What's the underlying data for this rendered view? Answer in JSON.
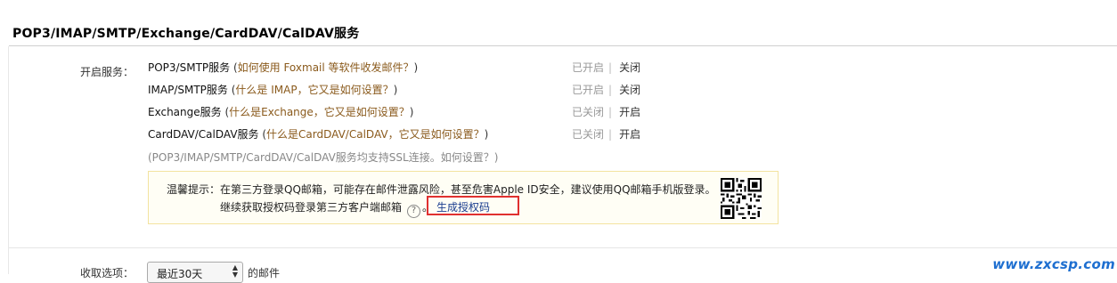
{
  "section": {
    "title": "POP3/IMAP/SMTP/Exchange/CardDAV/CalDAV服务"
  },
  "enable_label": "开启服务：",
  "services": [
    {
      "name": "POP3/SMTP服务",
      "open_paren": " (",
      "help": "如何使用 Foxmail 等软件收发邮件？",
      "close_paren": ")",
      "status": "已开启",
      "sep": "|",
      "action": "关闭"
    },
    {
      "name": "IMAP/SMTP服务",
      "open_paren": " (",
      "help": "什么是 IMAP，它又是如何设置？",
      "close_paren": ")",
      "status": "已开启",
      "sep": "|",
      "action": "关闭"
    },
    {
      "name": "Exchange服务",
      "open_paren": " (",
      "help": "什么是Exchange，它又是如何设置？",
      "close_paren": ")",
      "status": "已关闭",
      "sep": "|",
      "action": "开启"
    },
    {
      "name": "CardDAV/CalDAV服务",
      "open_paren": " (",
      "help": "什么是CardDAV/CalDAV，它又是如何设置？",
      "close_paren": ")",
      "status": "已关闭",
      "sep": "|",
      "action": "开启"
    }
  ],
  "ssl_note": "(POP3/IMAP/SMTP/CardDAV/CalDAV服务均支持SSL连接。如何设置？)",
  "tip": {
    "line1": "温馨提示：在第三方登录QQ邮箱，可能存在邮件泄露风险，甚至危害Apple ID安全，建议使用QQ邮箱手机版登录。",
    "line2": "继续获取授权码登录第三方客户端邮箱",
    "help_glyph": "?",
    "period": "。",
    "generate_label": "生成授权码"
  },
  "collect": {
    "label": "收取选项：",
    "select_value": "最近30天",
    "suffix": "的邮件"
  },
  "watermark": "www.zxcsp.com",
  "colors": {
    "highlight_border": "#e03030",
    "help_text": "#8a5a1c",
    "link": "#1a3d8f"
  }
}
